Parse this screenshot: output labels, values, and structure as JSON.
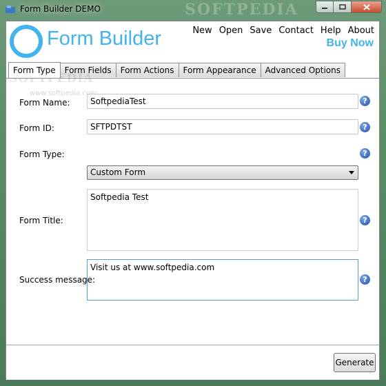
{
  "window": {
    "title": "Form Builder DEMO",
    "watermark": "SOFTPEDIA"
  },
  "header": {
    "logo_text": "Form Builder",
    "menu": [
      "New",
      "Open",
      "Save",
      "Contact",
      "Help",
      "About"
    ],
    "buy_now": "Buy Now"
  },
  "tabs": [
    "Form Type",
    "Form Fields",
    "Form Actions",
    "Form Appearance",
    "Advanced Options"
  ],
  "pane_watermark": {
    "big": "SOFTPEDIA",
    "small": "www.softpedia.com"
  },
  "form": {
    "name_label": "Form Name:",
    "name_value": "SoftpediaTest",
    "id_label": "Form ID:",
    "id_value": "SFTPDTST",
    "type_label": "Form Type:",
    "type_value": "Custom Form",
    "title_label": "Form Title:",
    "title_value": "Softpedia Test",
    "success_label": "Success message:",
    "success_value": "Visit us at www.softpedia.com"
  },
  "help_glyph": "?",
  "generate_label": "Generate",
  "colors": {
    "accent": "#41b4ec",
    "help": "#1e4fa8"
  }
}
